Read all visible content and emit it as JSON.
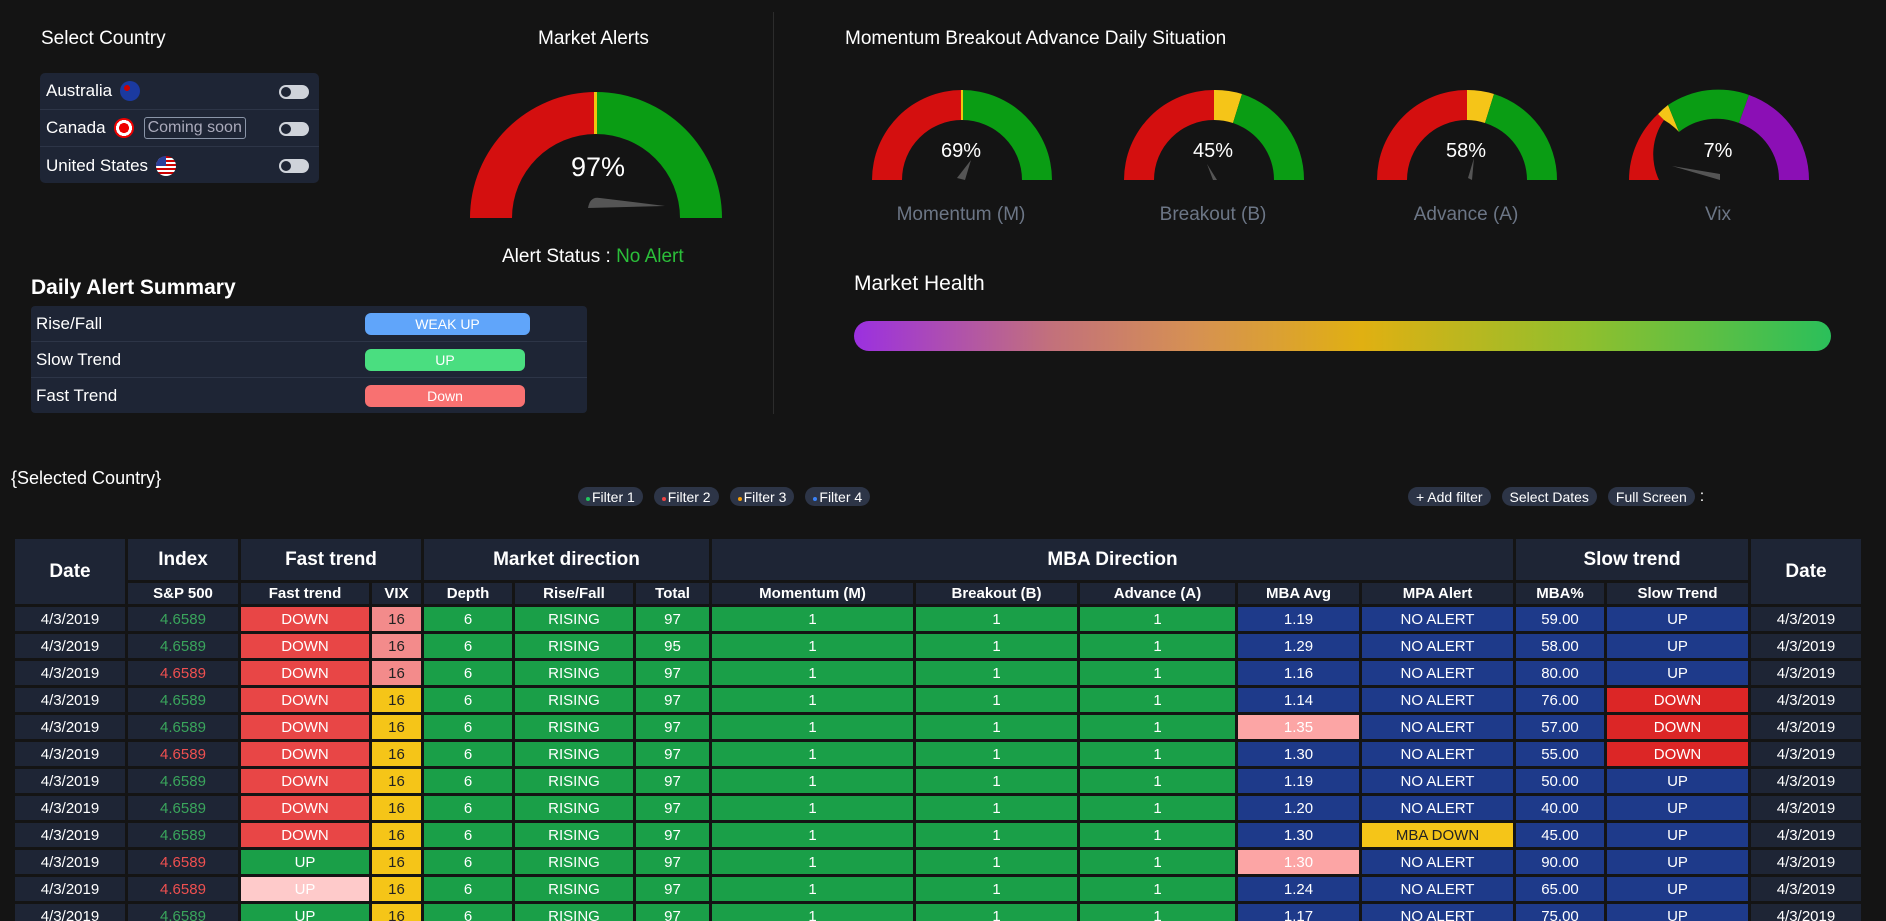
{
  "country_panel": {
    "title": "Select Country",
    "countries": [
      {
        "name": "Australia",
        "note": ""
      },
      {
        "name": "Canada",
        "note": "Coming soon"
      },
      {
        "name": "United States",
        "note": ""
      }
    ]
  },
  "market_alerts": {
    "title": "Market Alerts",
    "percent": 97,
    "value_text": "97%",
    "status_label": "Alert Status :",
    "status_value": "No Alert"
  },
  "mba": {
    "title": "Momentum Breakout Advance Daily Situation",
    "gauges": [
      {
        "label": "Momentum (M)",
        "value_text": "69%",
        "value": 69
      },
      {
        "label": "Breakout (B)",
        "value_text": "45%",
        "value": 45
      },
      {
        "label": "Advance (A)",
        "value_text": "58%",
        "value": 58
      },
      {
        "label": "Vix",
        "value_text": "7%",
        "value": 7
      }
    ]
  },
  "summary": {
    "title": "Daily Alert Summary",
    "rows": [
      {
        "label": "Rise/Fall",
        "value": "WEAK UP",
        "color": "#60a5fa"
      },
      {
        "label": "Slow Trend",
        "value": "UP",
        "color": "#4ade80"
      },
      {
        "label": "Fast Trend",
        "value": "Down",
        "color": "#f87171"
      }
    ]
  },
  "health": {
    "title": "Market Health"
  },
  "toolbar": {
    "selected_country": "{Selected Country}",
    "filters": [
      {
        "label": "Filter 1",
        "color": "#22c55e"
      },
      {
        "label": "Filter 2",
        "color": "#ef4444"
      },
      {
        "label": "Filter 3",
        "color": "#f59e0b"
      },
      {
        "label": "Filter 4",
        "color": "#3b82f6"
      }
    ],
    "add_filter": "+ Add filter",
    "select_dates": "Select Dates",
    "full_screen": "Full Screen",
    "more": ":"
  },
  "table": {
    "groups": {
      "date": "Date",
      "index": "Index",
      "fast": "Fast trend",
      "market": "Market direction",
      "mba": "MBA Direction",
      "slow": "Slow trend",
      "date2": "Date"
    },
    "columns": {
      "sp500": "S&P 500",
      "fast_trend": "Fast trend",
      "vix": "VIX",
      "depth": "Depth",
      "rise_fall": "Rise/Fall",
      "total": "Total",
      "momentum": "Momentum (M)",
      "breakout": "Breakout (B)",
      "advance": "Advance (A)",
      "mba_avg": "MBA Avg",
      "mpa_alert": "MPA Alert",
      "mba_pct": "MBA%",
      "slow_trend": "Slow Trend"
    },
    "rows": [
      {
        "date": "4/3/2019",
        "sp": "4.6589",
        "sp_color": "green",
        "fast": "DOWN",
        "fast_color": "red",
        "vix": "16",
        "vix_color": "pink",
        "depth": "6",
        "rf": "RISING",
        "total": "97",
        "m": "1",
        "b": "1",
        "a": "1",
        "avg": "1.19",
        "avg_color": "blue",
        "alert": "NO ALERT",
        "alert_color": "blue",
        "pct": "59.00",
        "slow": "UP",
        "slow_color": "blue",
        "date2": "4/3/2019"
      },
      {
        "date": "4/3/2019",
        "sp": "4.6589",
        "sp_color": "green",
        "fast": "DOWN",
        "fast_color": "red",
        "vix": "16",
        "vix_color": "pink",
        "depth": "6",
        "rf": "RISING",
        "total": "95",
        "m": "1",
        "b": "1",
        "a": "1",
        "avg": "1.29",
        "avg_color": "blue",
        "alert": "NO ALERT",
        "alert_color": "blue",
        "pct": "58.00",
        "slow": "UP",
        "slow_color": "blue",
        "date2": "4/3/2019"
      },
      {
        "date": "4/3/2019",
        "sp": "4.6589",
        "sp_color": "red",
        "fast": "DOWN",
        "fast_color": "red",
        "vix": "16",
        "vix_color": "pink",
        "depth": "6",
        "rf": "RISING",
        "total": "97",
        "m": "1",
        "b": "1",
        "a": "1",
        "avg": "1.16",
        "avg_color": "blue",
        "alert": "NO ALERT",
        "alert_color": "blue",
        "pct": "80.00",
        "slow": "UP",
        "slow_color": "blue",
        "date2": "4/3/2019"
      },
      {
        "date": "4/3/2019",
        "sp": "4.6589",
        "sp_color": "green",
        "fast": "DOWN",
        "fast_color": "red",
        "vix": "16",
        "vix_color": "yellow",
        "depth": "6",
        "rf": "RISING",
        "total": "97",
        "m": "1",
        "b": "1",
        "a": "1",
        "avg": "1.14",
        "avg_color": "blue",
        "alert": "NO ALERT",
        "alert_color": "blue",
        "pct": "76.00",
        "slow": "DOWN",
        "slow_color": "red",
        "date2": "4/3/2019"
      },
      {
        "date": "4/3/2019",
        "sp": "4.6589",
        "sp_color": "green",
        "fast": "DOWN",
        "fast_color": "red",
        "vix": "16",
        "vix_color": "yellow",
        "depth": "6",
        "rf": "RISING",
        "total": "97",
        "m": "1",
        "b": "1",
        "a": "1",
        "avg": "1.35",
        "avg_color": "pink",
        "alert": "NO ALERT",
        "alert_color": "blue",
        "pct": "57.00",
        "slow": "DOWN",
        "slow_color": "red",
        "date2": "4/3/2019"
      },
      {
        "date": "4/3/2019",
        "sp": "4.6589",
        "sp_color": "red",
        "fast": "DOWN",
        "fast_color": "red",
        "vix": "16",
        "vix_color": "yellow",
        "depth": "6",
        "rf": "RISING",
        "total": "97",
        "m": "1",
        "b": "1",
        "a": "1",
        "avg": "1.30",
        "avg_color": "blue",
        "alert": "NO ALERT",
        "alert_color": "blue",
        "pct": "55.00",
        "slow": "DOWN",
        "slow_color": "red",
        "date2": "4/3/2019"
      },
      {
        "date": "4/3/2019",
        "sp": "4.6589",
        "sp_color": "green",
        "fast": "DOWN",
        "fast_color": "red",
        "vix": "16",
        "vix_color": "yellow",
        "depth": "6",
        "rf": "RISING",
        "total": "97",
        "m": "1",
        "b": "1",
        "a": "1",
        "avg": "1.19",
        "avg_color": "blue",
        "alert": "NO ALERT",
        "alert_color": "blue",
        "pct": "50.00",
        "slow": "UP",
        "slow_color": "blue",
        "date2": "4/3/2019"
      },
      {
        "date": "4/3/2019",
        "sp": "4.6589",
        "sp_color": "green",
        "fast": "DOWN",
        "fast_color": "red",
        "vix": "16",
        "vix_color": "yellow",
        "depth": "6",
        "rf": "RISING",
        "total": "97",
        "m": "1",
        "b": "1",
        "a": "1",
        "avg": "1.20",
        "avg_color": "blue",
        "alert": "NO ALERT",
        "alert_color": "blue",
        "pct": "40.00",
        "slow": "UP",
        "slow_color": "blue",
        "date2": "4/3/2019"
      },
      {
        "date": "4/3/2019",
        "sp": "4.6589",
        "sp_color": "green",
        "fast": "DOWN",
        "fast_color": "red",
        "vix": "16",
        "vix_color": "yellow",
        "depth": "6",
        "rf": "RISING",
        "total": "97",
        "m": "1",
        "b": "1",
        "a": "1",
        "avg": "1.30",
        "avg_color": "blue",
        "alert": "MBA DOWN",
        "alert_color": "yellow",
        "pct": "45.00",
        "slow": "UP",
        "slow_color": "blue",
        "date2": "4/3/2019"
      },
      {
        "date": "4/3/2019",
        "sp": "4.6589",
        "sp_color": "red",
        "fast": "UP",
        "fast_color": "green",
        "vix": "16",
        "vix_color": "yellow",
        "depth": "6",
        "rf": "RISING",
        "total": "97",
        "m": "1",
        "b": "1",
        "a": "1",
        "avg": "1.30",
        "avg_color": "pink",
        "alert": "NO ALERT",
        "alert_color": "blue",
        "pct": "90.00",
        "slow": "UP",
        "slow_color": "blue",
        "date2": "4/3/2019"
      },
      {
        "date": "4/3/2019",
        "sp": "4.6589",
        "sp_color": "red",
        "fast": "UP",
        "fast_color": "lightpink",
        "vix": "16",
        "vix_color": "yellow",
        "depth": "6",
        "rf": "RISING",
        "total": "97",
        "m": "1",
        "b": "1",
        "a": "1",
        "avg": "1.24",
        "avg_color": "blue",
        "alert": "NO ALERT",
        "alert_color": "blue",
        "pct": "65.00",
        "slow": "UP",
        "slow_color": "blue",
        "date2": "4/3/2019"
      },
      {
        "date": "4/3/2019",
        "sp": "4.6589",
        "sp_color": "green",
        "fast": "UP",
        "fast_color": "green",
        "vix": "16",
        "vix_color": "yellow",
        "depth": "6",
        "rf": "RISING",
        "total": "97",
        "m": "1",
        "b": "1",
        "a": "1",
        "avg": "1.17",
        "avg_color": "blue",
        "alert": "NO ALERT",
        "alert_color": "blue",
        "pct": "75.00",
        "slow": "UP",
        "slow_color": "blue",
        "date2": "4/3/2019"
      }
    ]
  }
}
